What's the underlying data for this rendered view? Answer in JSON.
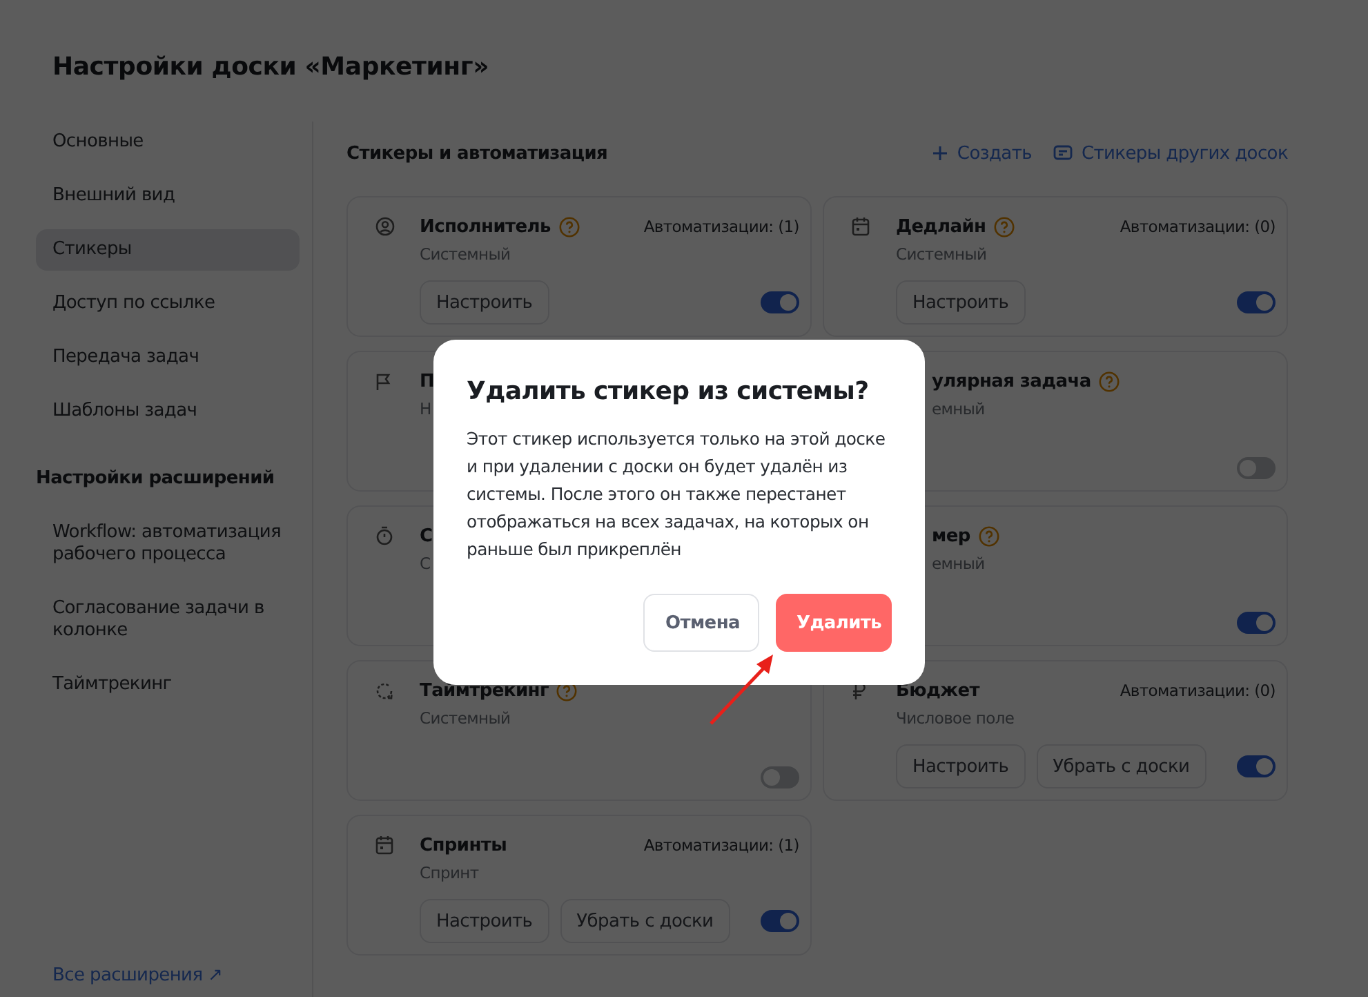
{
  "page": {
    "title": "Настройки доски «Маркетинг»"
  },
  "sidebar": {
    "items": [
      {
        "label": "Основные",
        "selected": false
      },
      {
        "label": "Внешний вид",
        "selected": false
      },
      {
        "label": "Стикеры",
        "selected": true
      },
      {
        "label": "Доступ по ссылке",
        "selected": false
      },
      {
        "label": "Передача задач",
        "selected": false
      },
      {
        "label": "Шаблоны задач",
        "selected": false
      }
    ],
    "extensions_heading": "Настройки расширений",
    "extensions": [
      {
        "label": "Workflow: автоматизация рабочего процесса"
      },
      {
        "label": "Согласование задачи в колонке"
      },
      {
        "label": "Таймтрекинг"
      }
    ],
    "all_extensions_link": "Все расширения ↗"
  },
  "section": {
    "title": "Стикеры и автоматизация",
    "actions": [
      {
        "kind": "create",
        "label": "Создать"
      },
      {
        "kind": "other-boards",
        "label": "Стикеры других досок"
      }
    ]
  },
  "cards": [
    {
      "kind": "person",
      "title": "Исполнитель",
      "help": true,
      "subtitle": "Системный",
      "automations": "Автоматизации: (1)",
      "buttons": [
        "Настроить"
      ],
      "on": true
    },
    {
      "kind": "calendar",
      "title": "Дедлайн",
      "help": true,
      "subtitle": "Системный",
      "automations": "Автоматизации: (0)",
      "buttons": [
        "Настроить"
      ],
      "on": true
    },
    {
      "kind": "flag",
      "title": "П",
      "subtitle": "Н"
    },
    {
      "title": "улярная задача",
      "help": true,
      "subtitle": "емный",
      "cut": true,
      "on": false
    },
    {
      "kind": "timer",
      "title": "С",
      "subtitle": "С"
    },
    {
      "title": "мер",
      "help": true,
      "subtitle": "емный",
      "cut": true,
      "on": true
    },
    {
      "kind": "timetrack",
      "title": "Таймтрекинг",
      "help": true,
      "subtitle": "Системный",
      "on": false
    },
    {
      "kind": "ruble",
      "title": "Бюджет",
      "help": false,
      "subtitle": "Числовое поле",
      "automations": "Автоматизации: (0)",
      "buttons": [
        "Настроить",
        "Убрать с доски"
      ],
      "on": true
    },
    {
      "kind": "calendar",
      "title": "Спринты",
      "help": false,
      "subtitle": "Спринт",
      "automations": "Автоматизации: (1)",
      "buttons": [
        "Настроить",
        "Убрать с доски"
      ],
      "on": true
    }
  ],
  "dialog": {
    "title": "Удалить стикер из системы?",
    "text": "Этот стикер используется только на этой доске и при удалении с доски он будет удалён из системы. После этого он также перестанет отображаться на всех задачах, на которых он раньше был прикреплён",
    "buttons": [
      {
        "kind": "secondary",
        "label": "Отмена"
      },
      {
        "kind": "danger",
        "label": "Удалить"
      }
    ]
  }
}
